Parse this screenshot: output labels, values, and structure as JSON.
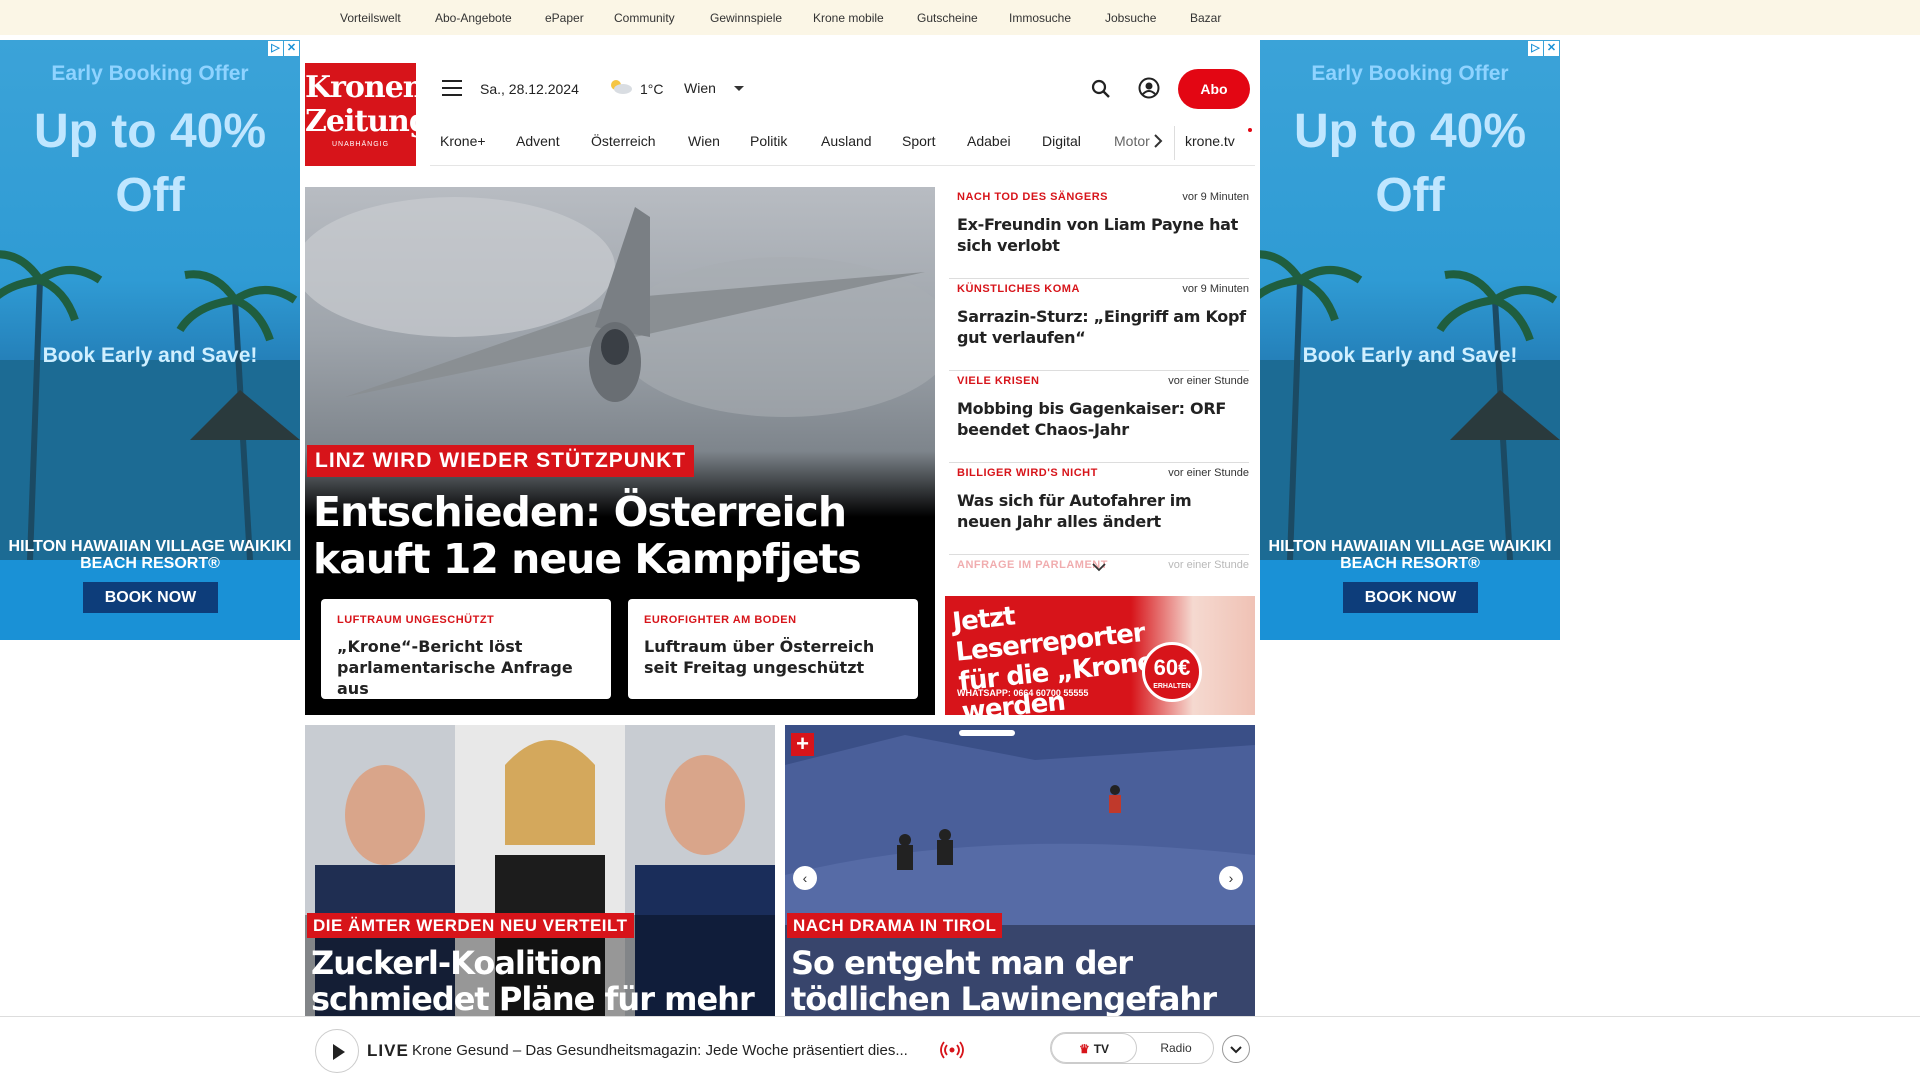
{
  "topnav": [
    "Vorteilswelt",
    "Abo-Angebote",
    "ePaper",
    "Community",
    "Gewinnspiele",
    "Krone mobile",
    "Gutscheine",
    "Immosuche",
    "Jobsuche",
    "Bazar"
  ],
  "ad": {
    "headline": "Early Booking Offer",
    "offer": "Up to 40% Off",
    "cta_text": "Book Early and Save!",
    "hotel": "HILTON HAWAIIAN VILLAGE WAIKIKI BEACH RESORT®",
    "button": "BOOK NOW",
    "colors": {
      "sky": "#3ba3d8",
      "button": "#0d3d7a"
    }
  },
  "header": {
    "logo_line1": "Kronen",
    "logo_line2": "Zeitung",
    "logo_sub": "UNABHÄNGIG",
    "date": "Sa., 28.12.2024",
    "temperature": "1°C",
    "city": "Wien",
    "abo_label": "Abo",
    "icons": [
      "menu-icon",
      "weather-icon",
      "search-icon",
      "user-icon"
    ]
  },
  "nav": [
    "Krone+",
    "Advent",
    "Österreich",
    "Wien",
    "Politik",
    "Ausland",
    "Sport",
    "Adabei",
    "Digital",
    "Motor",
    "krone.tv"
  ],
  "hero": {
    "tag": "LINZ WIRD WIEDER STÜTZPUNKT",
    "title": "Entschieden: Österreich kauft 12 neue Kampfjets",
    "subcards": [
      {
        "kicker": "LUFTRAUM UNGESCHÜTZT",
        "title": "„Krone“-Bericht löst parlamentarische Anfrage aus"
      },
      {
        "kicker": "EUROFIGHTER AM BODEN",
        "title": "Luftraum über Österreich seit Freitag ungeschützt"
      }
    ]
  },
  "side_news": [
    {
      "kicker": "NACH TOD DES SÄNGERS",
      "time": "vor 9 Minuten",
      "title": "Ex-Freundin von Liam Payne hat sich verlobt"
    },
    {
      "kicker": "KÜNSTLICHES KOMA",
      "time": "vor 9 Minuten",
      "title": "Sarrazin-Sturz: „Eingriff am Kopf gut verlaufen“"
    },
    {
      "kicker": "VIELE KRISEN",
      "time": "vor einer Stunde",
      "title": "Mobbing bis Gagenkaiser: ORF beendet Chaos-Jahr"
    },
    {
      "kicker": "BILLIGER WIRD'S NICHT",
      "time": "vor einer Stunde",
      "title": "Was sich für Autofahrer im neuen Jahr alles ändert"
    },
    {
      "kicker": "ANFRAGE IM PARLAMENT",
      "time": "vor einer Stunde",
      "title": ""
    }
  ],
  "promo": {
    "title": "Jetzt Leserreporter für die „Krone“ werden",
    "whatsapp": "WHATSAPP: 0664 60700 55555",
    "badge_amount": "60€",
    "badge_text": "ERHALTEN"
  },
  "cards": [
    {
      "tag": "DIE ÄMTER WERDEN NEU VERTEILT",
      "title": "Zuckerl-Koalition schmiedet Pläne für mehr Ministerien"
    },
    {
      "tag": "NACH DRAMA IN TIROL",
      "title": "So entgeht man der tödlichen Lawinengefahr auf den Bergen"
    }
  ],
  "live": {
    "label": "LIVE",
    "text": "Krone Gesund – Das Gesundheitsmagazin: Jede Woche präsentiert dies...",
    "tv": "TV",
    "radio": "Radio"
  }
}
